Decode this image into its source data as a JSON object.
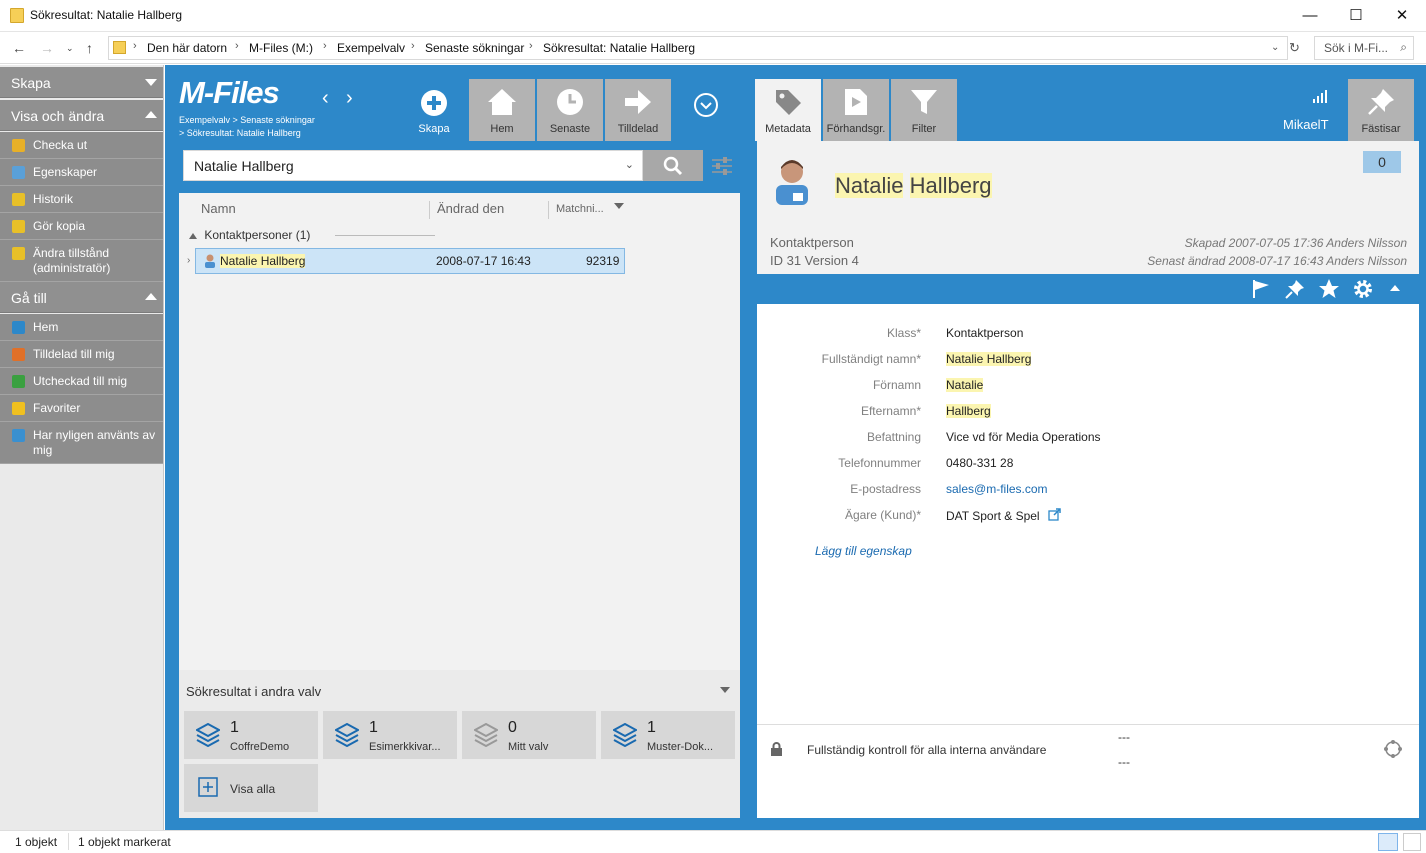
{
  "window": {
    "title": "Sökresultat: Natalie Hallberg",
    "minimize": "—",
    "maximize": "☐",
    "close": "✕"
  },
  "address": {
    "segments": [
      "Den här datorn",
      "M-Files (M:)",
      "Exempelvalv",
      "Senaste sökningar",
      "Sökresultat: Natalie Hallberg"
    ],
    "search_placeholder": "Sök i M-Fi..."
  },
  "sidebar": {
    "create": "Skapa",
    "view_edit": "Visa och ändra",
    "actions": [
      {
        "label": "Checka ut",
        "color": "#e8b028"
      },
      {
        "label": "Egenskaper",
        "color": "#5aa0d8"
      },
      {
        "label": "Historik",
        "color": "#e8c028"
      },
      {
        "label": "Gör kopia",
        "color": "#e8c028"
      },
      {
        "label": "Ändra tillstånd (administratör)",
        "color": "#e8c028"
      }
    ],
    "goto": "Gå till",
    "goto_items": [
      {
        "label": "Hem",
        "color": "#2d88c9"
      },
      {
        "label": "Tilldelad till mig",
        "color": "#e07028"
      },
      {
        "label": "Utcheckad till mig",
        "color": "#3aa040"
      },
      {
        "label": "Favoriter",
        "color": "#f0c020"
      },
      {
        "label": "Har nyligen använts av mig",
        "color": "#3a90d0"
      }
    ]
  },
  "center": {
    "logo": "M-Files",
    "breadcrumb1": "Exempelvalv > Senaste sökningar",
    "breadcrumb2": "> Sökresultat: Natalie Hallberg",
    "buttons": {
      "create": "Skapa",
      "home": "Hem",
      "recent": "Senaste",
      "assigned": "Tilldelad"
    },
    "search_value": "Natalie Hallberg",
    "columns": {
      "name": "Namn",
      "modified": "Ändrad den",
      "match": "Matchni..."
    },
    "group": "Kontaktpersoner (1)",
    "results": [
      {
        "name": "Natalie Hallberg",
        "modified": "2008-07-17 16:43",
        "score": "92319"
      }
    ],
    "other_vaults_title": "Sökresultat i andra valv",
    "vaults": [
      {
        "count": "1",
        "name": "CoffreDemo",
        "active": true
      },
      {
        "count": "1",
        "name": "Esimerkkivar...",
        "active": true
      },
      {
        "count": "0",
        "name": "Mitt valv",
        "active": false
      },
      {
        "count": "1",
        "name": "Muster-Dok...",
        "active": true
      }
    ],
    "show_all": "Visa alla"
  },
  "right": {
    "tabs": {
      "metadata": "Metadata",
      "preview": "Förhandsgr.",
      "filter": "Filter",
      "pin": "Fästisar"
    },
    "user": "MikaelT",
    "comment_count": "0",
    "title_first": "Natalie",
    "title_last": "Hallberg",
    "class": "Kontaktperson",
    "id_version": "ID 31  Version 4",
    "created": "Skapad 2007-07-05 17:36 Anders Nilsson",
    "modified": "Senast ändrad 2008-07-17 16:43 Anders Nilsson",
    "props": [
      {
        "label": "Klass*",
        "value": "Kontaktperson",
        "hl": false,
        "link": false
      },
      {
        "label": "Fullständigt namn*",
        "value": "Natalie Hallberg",
        "hl": true,
        "link": false
      },
      {
        "label": "Förnamn",
        "value": "Natalie",
        "hl": true,
        "link": false
      },
      {
        "label": "Efternamn*",
        "value": "Hallberg",
        "hl": true,
        "link": false
      },
      {
        "label": "Befattning",
        "value": "Vice vd för Media Operations",
        "hl": false,
        "link": false
      },
      {
        "label": "Telefonnummer",
        "value": "0480-331 28",
        "hl": false,
        "link": false
      },
      {
        "label": "E-postadress",
        "value": "sales@m-files.com",
        "hl": false,
        "link": true
      },
      {
        "label": "Ägare (Kund)*",
        "value": "DAT Sport & Spel",
        "hl": false,
        "link": false
      }
    ],
    "add_property": "Lägg till egenskap",
    "permissions": "Fullständig kontroll för alla interna användare",
    "dash1": "---",
    "dash2": "---"
  },
  "status": {
    "objects": "1 objekt",
    "selected": "1 objekt markerat"
  }
}
